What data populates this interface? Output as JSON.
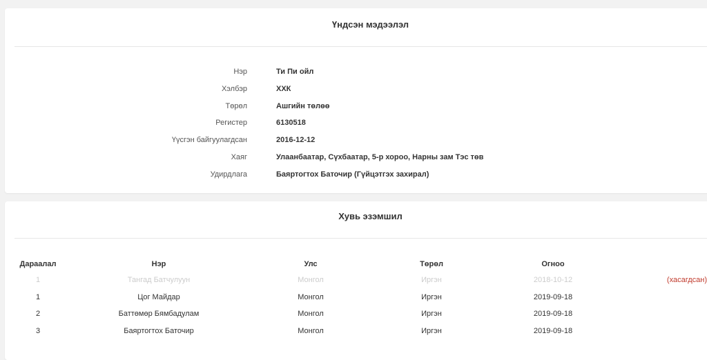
{
  "basic_info": {
    "title": "Үндсэн мэдээлэл",
    "fields": [
      {
        "label": "Нэр",
        "value": "Ти Пи ойл"
      },
      {
        "label": "Хэлбэр",
        "value": "ХХК"
      },
      {
        "label": "Төрөл",
        "value": "Ашгийн төлөө"
      },
      {
        "label": "Регистер",
        "value": "6130518"
      },
      {
        "label": "Үүсгэн байгуулагдсан",
        "value": "2016-12-12"
      },
      {
        "label": "Хаяг",
        "value": "Улаанбаатар, Сүхбаатар, 5-р хороо, Нарны зам Тэс төв"
      },
      {
        "label": "Удирдлага",
        "value": "Баяртогтох Баточир (Гүйцэтгэх захирал)"
      }
    ]
  },
  "ownership": {
    "title": "Хувь эзэмшил",
    "columns": {
      "index": "Дараалал",
      "name": "Нэр",
      "country": "Улс",
      "type": "Төрөл",
      "date": "Огноо"
    },
    "rows": [
      {
        "index": "1",
        "name": "Тангад Батчулуун",
        "country": "Монгол",
        "type": "Иргэн",
        "date": "2018-10-12",
        "status": "(хасагдсан)"
      },
      {
        "index": "1",
        "name": "Цог Майдар",
        "country": "Монгол",
        "type": "Иргэн",
        "date": "2019-09-18",
        "status": ""
      },
      {
        "index": "2",
        "name": "Баттөмөр Бямбадулам",
        "country": "Монгол",
        "type": "Иргэн",
        "date": "2019-09-18",
        "status": ""
      },
      {
        "index": "3",
        "name": "Баяртогтох Баточир",
        "country": "Монгол",
        "type": "Иргэн",
        "date": "2019-09-18",
        "status": ""
      }
    ],
    "colors": {
      "removed_text": "#cccccc",
      "removed_status": "#c0392b"
    }
  }
}
